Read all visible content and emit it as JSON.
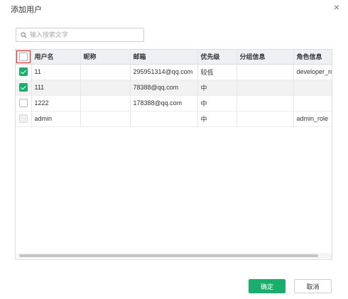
{
  "dialog": {
    "title": "添加用户",
    "close_glyph": "×"
  },
  "search": {
    "placeholder": "输入搜索文字"
  },
  "table": {
    "columns": [
      "用户名",
      "昵称",
      "邮箱",
      "优先级",
      "分组信息",
      "角色信息"
    ],
    "rows": [
      {
        "checked": true,
        "disabled": false,
        "highlight": false,
        "username": "11",
        "nickname": "",
        "email": "295951314@qq.com",
        "priority": "较低",
        "group": "",
        "role": "developer_ro"
      },
      {
        "checked": true,
        "disabled": false,
        "highlight": true,
        "username": "111",
        "nickname": "",
        "email": "78388@qq.com",
        "priority": "中",
        "group": "",
        "role": ""
      },
      {
        "checked": false,
        "disabled": false,
        "highlight": false,
        "username": "1222",
        "nickname": "",
        "email": "178388@qq.com",
        "priority": "中",
        "group": "",
        "role": ""
      },
      {
        "checked": false,
        "disabled": true,
        "highlight": false,
        "username": "admin",
        "nickname": "",
        "email": "",
        "priority": "中",
        "group": "",
        "role": "admin_role"
      }
    ]
  },
  "buttons": {
    "confirm": "确定",
    "cancel": "取消"
  },
  "colors": {
    "accent": "#1aad6b",
    "select_all_outline": "#e02020"
  }
}
